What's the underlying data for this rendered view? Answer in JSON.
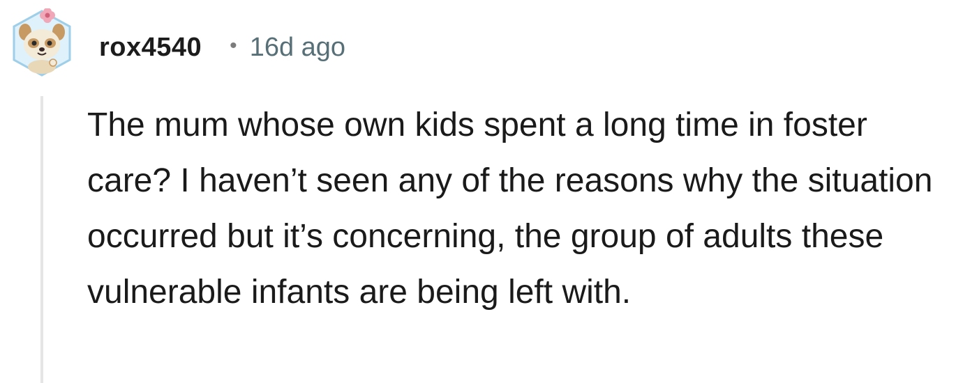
{
  "comment": {
    "author": "rox4540",
    "separator": "•",
    "timestamp": "16d ago",
    "body": "The mum whose own kids spent a long time in foster care? I haven’t seen any of the reasons why the situation occurred but it’s concerning, the group of adults these vulnerable infants are being left with.",
    "avatar_icon": "snoo-avatar-icon"
  }
}
